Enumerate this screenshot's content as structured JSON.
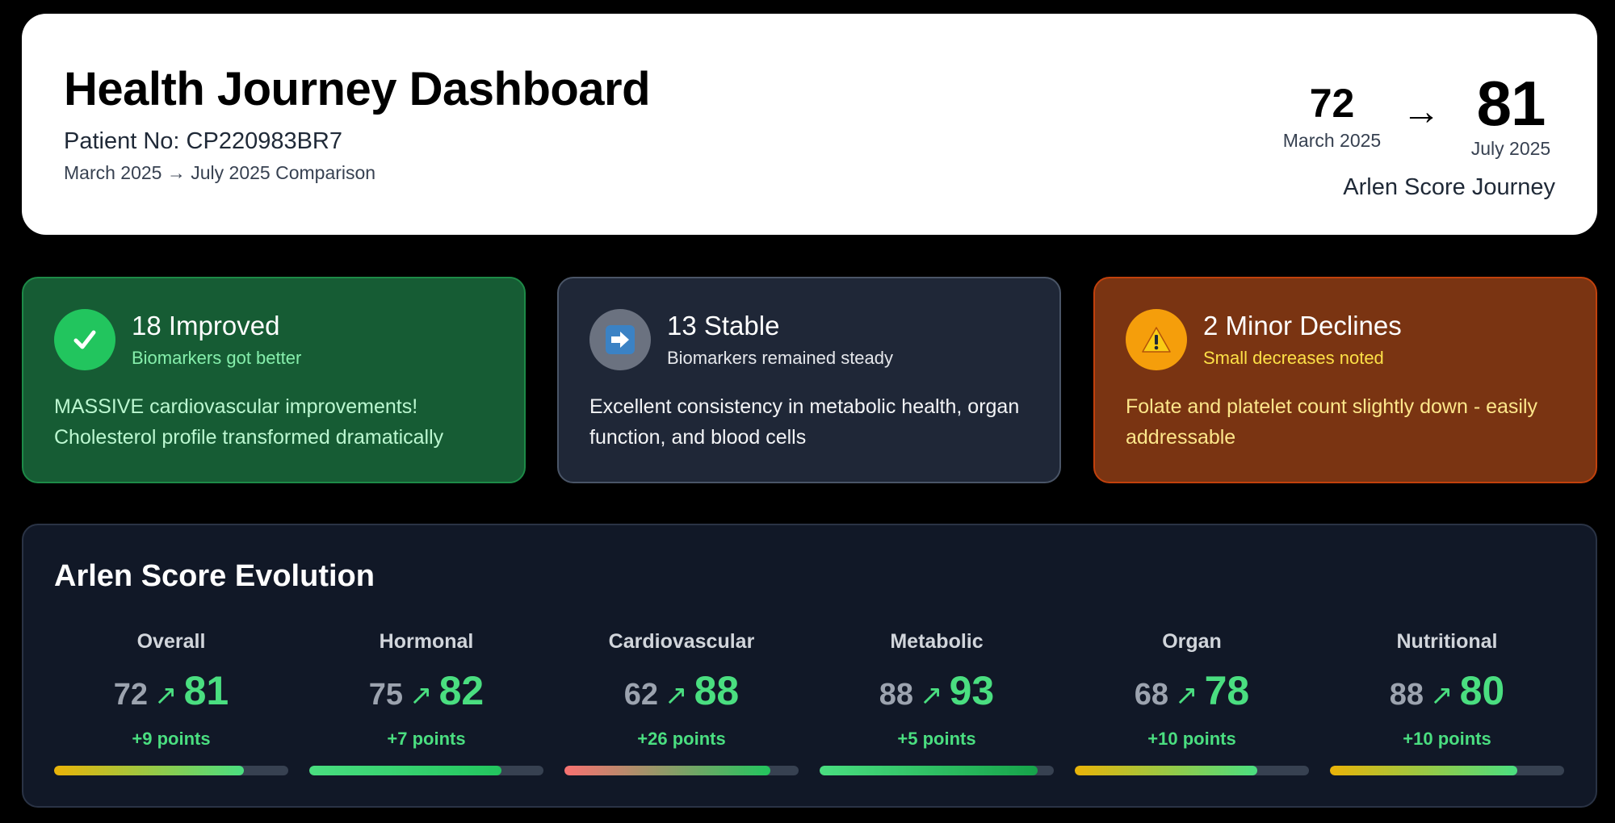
{
  "header": {
    "title": "Health Journey Dashboard",
    "patient": "Patient No: CP220983BR7",
    "comparison": "March 2025 → July 2025 Comparison",
    "score_from": "72",
    "score_from_label": "March 2025",
    "score_arrow": "→",
    "score_to": "81",
    "score_to_label": "July 2025",
    "score_caption": "Arlen Score Journey"
  },
  "cards": {
    "improved": {
      "icon": "check-icon",
      "title": "18 Improved",
      "subtitle": "Biomarkers got better",
      "body": "MASSIVE cardiovascular improvements! Cholesterol profile transformed dramatically",
      "bg": "#165c34",
      "accent": "#86efac"
    },
    "stable": {
      "icon": "arrow-right-icon",
      "title": "13 Stable",
      "subtitle": "Biomarkers remained steady",
      "body": "Excellent consistency in metabolic health, organ function, and blood cells",
      "bg": "#1f2737",
      "accent": "#e5e7eb"
    },
    "declines": {
      "icon": "warning-icon",
      "title": "2 Minor Declines",
      "subtitle": "Small decreases noted",
      "body": "Folate and platelet count slightly down - easily addressable",
      "bg": "#7a3412",
      "accent": "#fde047"
    }
  },
  "evolution": {
    "title": "Arlen Score Evolution",
    "arrow": "↗",
    "metrics": [
      {
        "name": "Overall",
        "from": "72",
        "to": "81",
        "delta": "+9 points",
        "progress": 0.81,
        "gradient": [
          "#eab308",
          "#4ade80"
        ]
      },
      {
        "name": "Hormonal",
        "from": "75",
        "to": "82",
        "delta": "+7 points",
        "progress": 0.82,
        "gradient": [
          "#4ade80",
          "#22c55e"
        ]
      },
      {
        "name": "Cardiovascular",
        "from": "62",
        "to": "88",
        "delta": "+26 points",
        "progress": 0.88,
        "gradient": [
          "#f87171",
          "#22c55e"
        ]
      },
      {
        "name": "Metabolic",
        "from": "88",
        "to": "93",
        "delta": "+5 points",
        "progress": 0.93,
        "gradient": [
          "#4ade80",
          "#16a34a"
        ]
      },
      {
        "name": "Organ",
        "from": "68",
        "to": "78",
        "delta": "+10 points",
        "progress": 0.78,
        "gradient": [
          "#eab308",
          "#4ade80"
        ]
      },
      {
        "name": "Nutritional",
        "from": "88",
        "to": "80",
        "delta": "+10 points",
        "progress": 0.8,
        "gradient": [
          "#eab308",
          "#4ade80"
        ]
      }
    ]
  }
}
